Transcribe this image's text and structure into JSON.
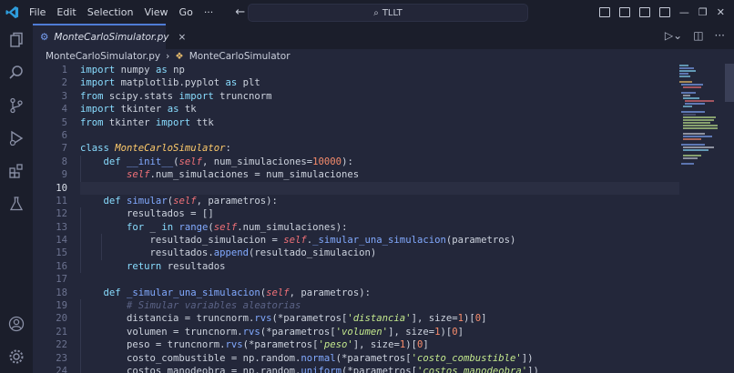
{
  "menu": [
    "File",
    "Edit",
    "Selection",
    "View",
    "Go",
    "···"
  ],
  "search": {
    "label": "TLLT"
  },
  "tab": {
    "filename": "MonteCarloSimulator.py",
    "close": "×"
  },
  "breadcrumb": {
    "file": "MonteCarloSimulator.py",
    "symbol": "MonteCarloSimulator"
  },
  "colors": {
    "accent": "#4f7cd6",
    "editor_bg": "#23273a",
    "chrome_bg": "#1b1e2b"
  },
  "editor": {
    "active_line": 10,
    "lines": [
      {
        "n": "1",
        "text": "import numpy as np"
      },
      {
        "n": "2",
        "text": "import matplotlib.pyplot as plt"
      },
      {
        "n": "3",
        "text": "from scipy.stats import truncnorm"
      },
      {
        "n": "4",
        "text": "import tkinter as tk"
      },
      {
        "n": "5",
        "text": "from tkinter import ttk"
      },
      {
        "n": "6",
        "text": ""
      },
      {
        "n": "7",
        "text": "class MonteCarloSimulator:"
      },
      {
        "n": "8",
        "text": "    def __init__(self, num_simulaciones=10000):"
      },
      {
        "n": "9",
        "text": "        self.num_simulaciones = num_simulaciones"
      },
      {
        "n": "10",
        "text": ""
      },
      {
        "n": "11",
        "text": "    def simular(self, parametros):"
      },
      {
        "n": "12",
        "text": "        resultados = []"
      },
      {
        "n": "13",
        "text": "        for _ in range(self.num_simulaciones):"
      },
      {
        "n": "14",
        "text": "            resultado_simulacion = self._simular_una_simulacion(parametros)"
      },
      {
        "n": "15",
        "text": "            resultados.append(resultado_simulacion)"
      },
      {
        "n": "16",
        "text": "        return resultados"
      },
      {
        "n": "17",
        "text": ""
      },
      {
        "n": "18",
        "text": "    def _simular_una_simulacion(self, parametros):"
      },
      {
        "n": "19",
        "text": "        # Simular variables aleatorias"
      },
      {
        "n": "20",
        "text": "        distancia = truncnorm.rvs(*parametros['distancia'], size=1)[0]"
      },
      {
        "n": "21",
        "text": "        volumen = truncnorm.rvs(*parametros['volumen'], size=1)[0]"
      },
      {
        "n": "22",
        "text": "        peso = truncnorm.rvs(*parametros['peso'], size=1)[0]"
      },
      {
        "n": "23",
        "text": "        costo_combustible = np.random.normal(*parametros['costo_combustible'])"
      },
      {
        "n": "24",
        "text": "        costos_manodeobra = np.random.uniform(*parametros['costos_manodeobra'])"
      }
    ]
  }
}
